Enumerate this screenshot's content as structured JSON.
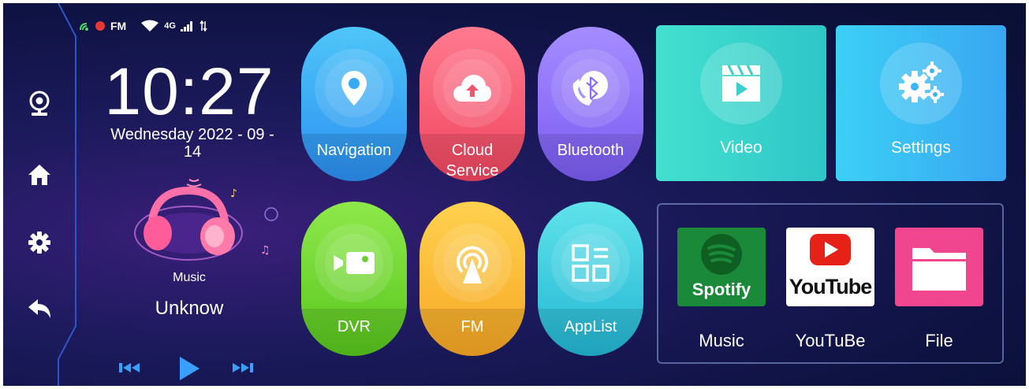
{
  "status_bar": {
    "fm_label": "FM",
    "network_label": "4G"
  },
  "clock": {
    "time": "10:27",
    "date_line1": "Wednesday  2022 - 09 -",
    "date_line2": "14"
  },
  "sidebar": {
    "items": [
      {
        "icon": "camera-icon"
      },
      {
        "icon": "home-icon"
      },
      {
        "icon": "gear-icon"
      },
      {
        "icon": "back-icon"
      }
    ]
  },
  "music": {
    "label": "Music",
    "title": "Unknow"
  },
  "pills": [
    {
      "label": "Navigation",
      "color_top": "#4fc6f8",
      "color_bottom": "#2b8ff0",
      "icon": "location-pin-icon"
    },
    {
      "label_line1": "Cloud",
      "label_line2": "Service",
      "color_top": "#ff7a8f",
      "color_bottom": "#f0465f",
      "icon": "cloud-upload-icon"
    },
    {
      "label": "Bluetooth",
      "color_top": "#a58cff",
      "color_bottom": "#7a5cf2",
      "icon": "bluetooth-phone-icon"
    },
    {
      "label": "DVR",
      "color_top": "#8ee84a",
      "color_bottom": "#58c61e",
      "icon": "video-camera-icon"
    },
    {
      "label": "FM",
      "color_top": "#ffd24f",
      "color_bottom": "#f6a623",
      "icon": "radio-antenna-icon"
    },
    {
      "label": "AppList",
      "color_top": "#5fe3ea",
      "color_bottom": "#23b6d4",
      "icon": "app-grid-icon"
    }
  ],
  "tiles": [
    {
      "label": "Video",
      "color_left": "#43e0cf",
      "color_right": "#2fc6c8",
      "icon": "clapperboard-icon"
    },
    {
      "label": "Settings",
      "color_left": "#3bd0f5",
      "color_right": "#39a6f2",
      "icon": "gears-icon"
    }
  ],
  "apps": [
    {
      "label": "Music",
      "brand": "Spotify",
      "bg": "#1a8a3a"
    },
    {
      "label": "YouTuBe",
      "brand": "YouTube",
      "bg": "#ffffff"
    },
    {
      "label": "File",
      "bg": "#f0468f"
    }
  ]
}
